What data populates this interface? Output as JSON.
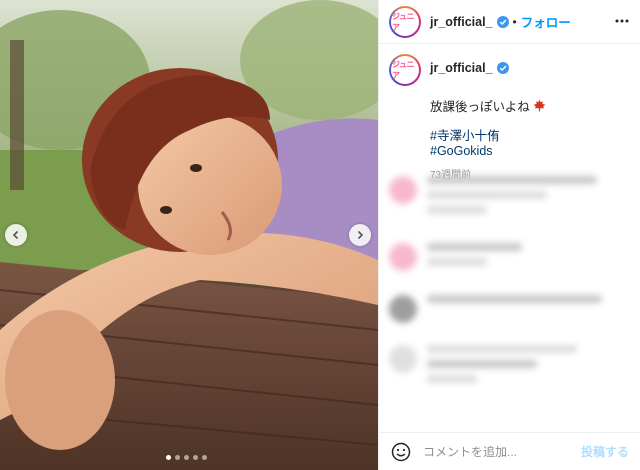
{
  "post": {
    "account_name": "jr_official_",
    "avatar_text": "ジュニア",
    "follow_label": "フォロー",
    "separator": "•",
    "caption_text": "放課後っぽいよね",
    "caption_emoji": "maple-leaf-icon",
    "hashtags": [
      "#寺澤小十侑",
      "#GoGokids"
    ],
    "posted_ago": "73週間前"
  },
  "carousel": {
    "dot_count": 5,
    "active_index": 0
  },
  "comment_box": {
    "placeholder": "コメントを追加...",
    "post_label": "投稿する"
  },
  "colors": {
    "follow_blue": "#0095f6",
    "hashtag_blue": "#00376b",
    "verified_blue": "#3897f0",
    "avatar_pink": "#ff4f8a"
  }
}
